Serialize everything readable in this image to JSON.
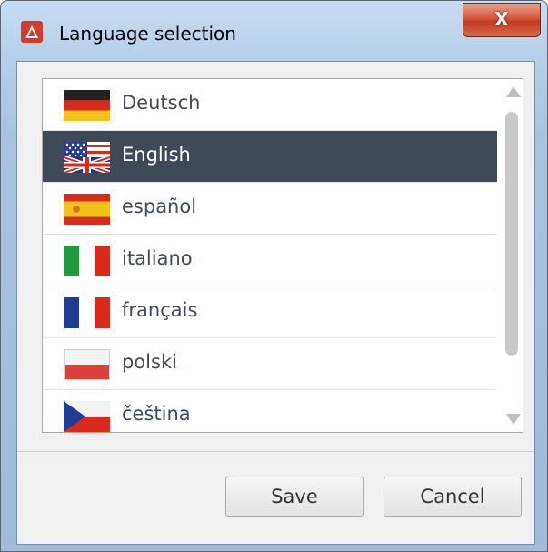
{
  "window": {
    "title": "Language selection",
    "close_label": "X"
  },
  "languages": [
    {
      "label": "Deutsch",
      "flag": "flag-germany",
      "selected": false
    },
    {
      "label": "English",
      "flag": "flag-united-kingdom",
      "selected": true
    },
    {
      "label": "español",
      "flag": "flag-spain",
      "selected": false
    },
    {
      "label": "italiano",
      "flag": "flag-italy",
      "selected": false
    },
    {
      "label": "français",
      "flag": "flag-france",
      "selected": false
    },
    {
      "label": "polski",
      "flag": "flag-poland",
      "selected": false
    },
    {
      "label": "čeština",
      "flag": "flag-czech-republic",
      "selected": false
    }
  ],
  "buttons": {
    "save_label": "Save",
    "cancel_label": "Cancel"
  },
  "colors": {
    "selected_row": "#3e4a55",
    "close_button": "#c8432a"
  }
}
